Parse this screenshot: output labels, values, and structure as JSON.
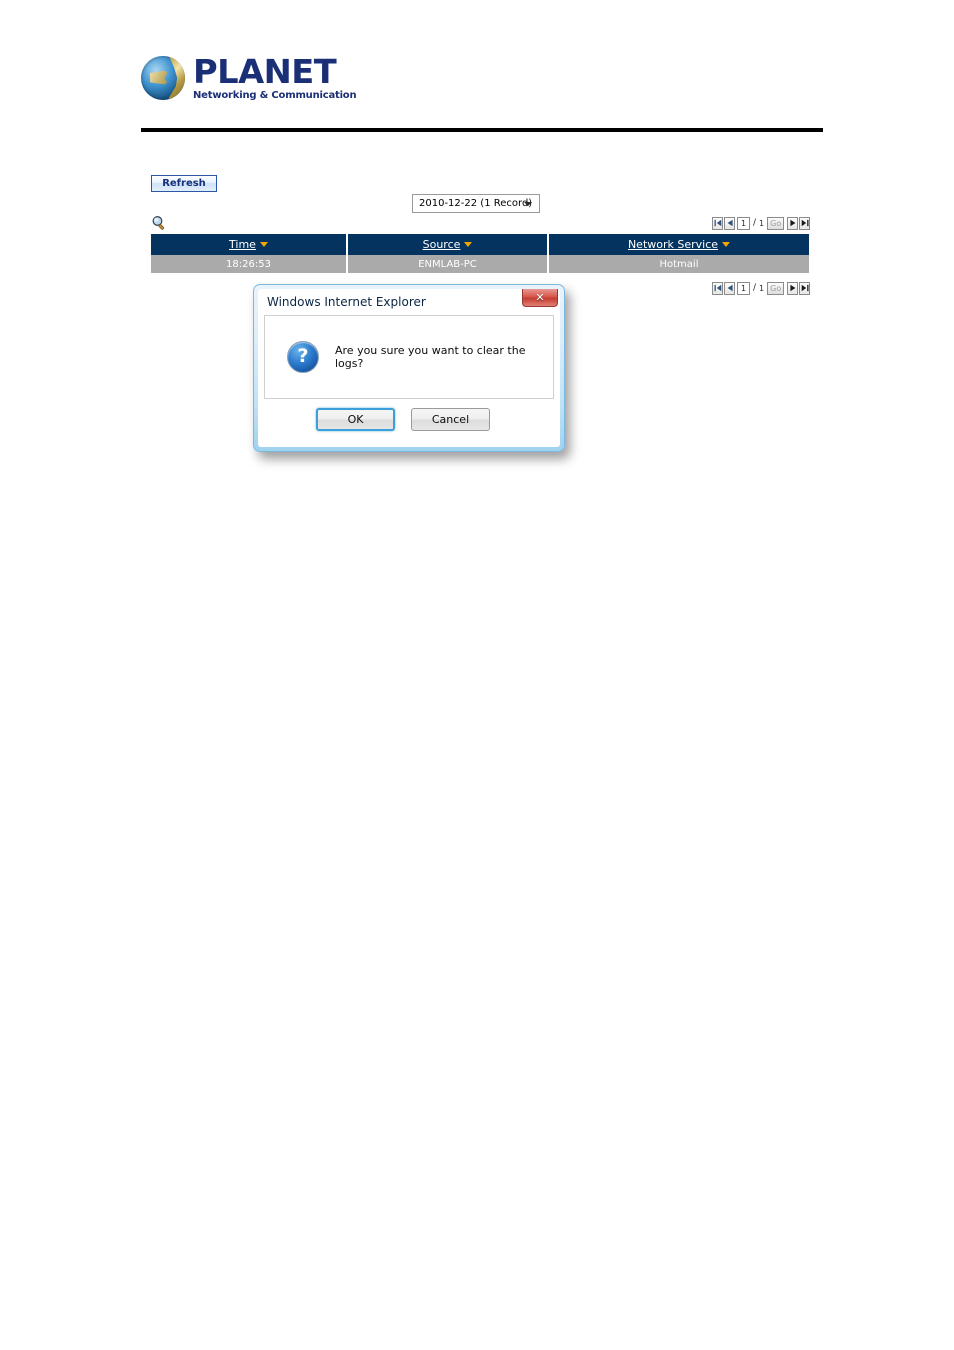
{
  "header": {
    "logo_name": "PLANET",
    "logo_tagline": "Networking & Communication",
    "globe_icon": "globe-icon"
  },
  "toolbar": {
    "refresh_label": "Refresh"
  },
  "filter": {
    "date_select_value": "2010-12-22 (1 Record)",
    "caret_icon": "chevron-down-icon",
    "search_icon": "search-icon"
  },
  "pagination": {
    "first_icon": "first-page-icon",
    "prev_icon": "previous-page-icon",
    "next_icon": "next-page-icon",
    "last_icon": "last-page-icon",
    "page_value": "1",
    "separator": "/",
    "total_pages": "1",
    "go_label": "Go"
  },
  "table": {
    "columns": [
      {
        "label": "Time",
        "sort_icon": "sort-descending-icon"
      },
      {
        "label": "Source",
        "sort_icon": "sort-descending-icon"
      },
      {
        "label": "Network Service",
        "sort_icon": "sort-descending-icon"
      }
    ],
    "rows": [
      {
        "time": "18:26:53",
        "source": "ENMLAB-PC",
        "service": "Hotmail"
      }
    ]
  },
  "dialog": {
    "title": "Windows Internet Explorer",
    "close_icon": "close-icon",
    "close_glyph": "✕",
    "question_icon": "question-mark-icon",
    "question_glyph": "?",
    "message": "Are you sure you want to clear the logs?",
    "ok_label": "OK",
    "cancel_label": "Cancel"
  },
  "colors": {
    "table_header_bg": "#05335f",
    "table_row_bg": "#aaaaaa",
    "sort_arrow": "#f0a500",
    "logo_blue": "#1b2f77",
    "dialog_accent": "#3c9fd8",
    "close_red": "#c33e31"
  }
}
